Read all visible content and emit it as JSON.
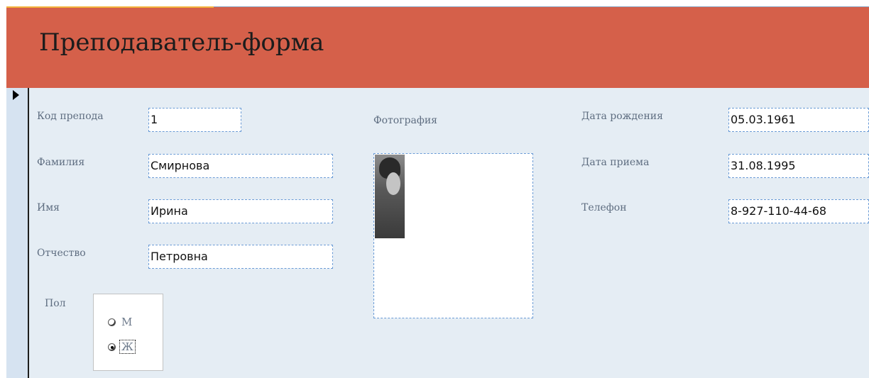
{
  "header": {
    "title": "Преподаватель-форма"
  },
  "fields": {
    "teacher_code": {
      "label": "Код препода",
      "value": "1"
    },
    "last_name": {
      "label": "Фамилия",
      "value": "Смирнова"
    },
    "first_name": {
      "label": "Имя",
      "value": "Ирина"
    },
    "patronymic": {
      "label": "Отчество",
      "value": "Петровна"
    },
    "photo": {
      "label": "Фотография"
    },
    "birth_date": {
      "label": "Дата рождения",
      "value": "05.03.1961"
    },
    "hire_date": {
      "label": "Дата приема",
      "value": "31.08.1995"
    },
    "phone": {
      "label": "Телефон",
      "value": "8-927-110-44-68"
    }
  },
  "gender": {
    "label": "Пол",
    "options": [
      {
        "label": "М",
        "selected": false
      },
      {
        "label": "Ж",
        "selected": true
      }
    ]
  },
  "colors": {
    "header": "#d5604a",
    "form_background": "#e5edf4",
    "record_selector": "#d6e3f1"
  }
}
